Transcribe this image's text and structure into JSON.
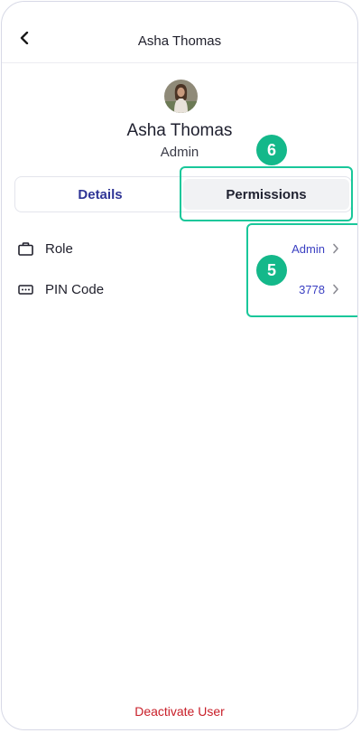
{
  "header": {
    "title": "Asha Thomas",
    "back_icon": "chevron-left-icon"
  },
  "profile": {
    "name": "Asha Thomas",
    "role": "Admin",
    "avatar_icon": "user-photo-avatar"
  },
  "tabs": [
    {
      "label": "Details",
      "selected": false
    },
    {
      "label": "Permissions",
      "selected": true
    }
  ],
  "settings": [
    {
      "label": "Role",
      "value": "Admin",
      "icon": "briefcase-icon"
    },
    {
      "label": "PIN Code",
      "value": "3778",
      "icon": "pin-dots-icon"
    }
  ],
  "annotations": {
    "badge_tabs": "6",
    "badge_rows": "5",
    "highlight_color": "#19c79a",
    "badge_color": "#14b88a"
  },
  "footer": {
    "deactivate_label": "Deactivate User",
    "deactivate_color": "#c81e28"
  },
  "colors": {
    "accent": "#3a3fc2",
    "tab_text": "#2f3596"
  }
}
